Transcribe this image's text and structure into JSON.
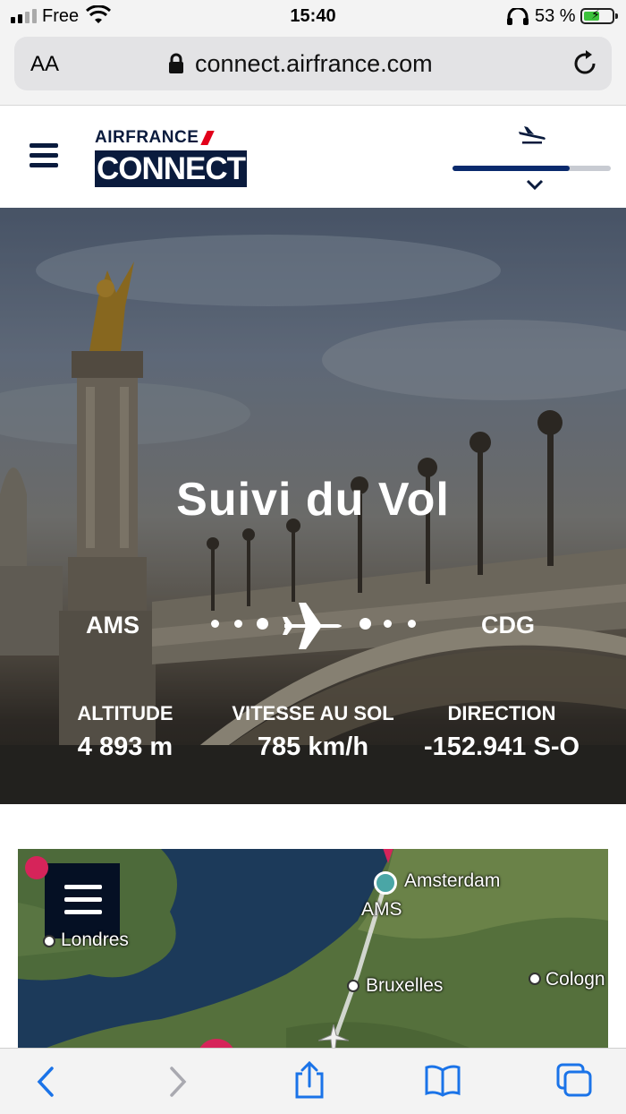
{
  "status_bar": {
    "carrier": "Free",
    "time": "15:40",
    "battery_text": "53 %"
  },
  "browser": {
    "text_size_label": "AA",
    "url": "connect.airfrance.com"
  },
  "header": {
    "logo_top": "AIRFRANCE",
    "logo_bottom": "CONNECT",
    "flight_progress": 0.74
  },
  "hero": {
    "title": "Suivi du Vol",
    "origin": "AMS",
    "destination": "CDG",
    "stats": [
      {
        "label": "ALTITUDE",
        "value": "4 893 m"
      },
      {
        "label": "VITESSE AU SOL",
        "value": "785 km/h"
      },
      {
        "label": "DIRECTION",
        "value": "-152.941 S-O"
      }
    ]
  },
  "map": {
    "labels": {
      "amsterdam": "Amsterdam",
      "ams": "AMS",
      "londres": "Londres",
      "bruxelles": "Bruxelles",
      "cologne": "Cologn"
    }
  },
  "colors": {
    "brand_navy": "#0a1b3d",
    "progress_fill": "#0a2a6d",
    "brand_red": "#e2001a",
    "map_marker": "#d6245a",
    "current_position": "#4aa6a6"
  }
}
